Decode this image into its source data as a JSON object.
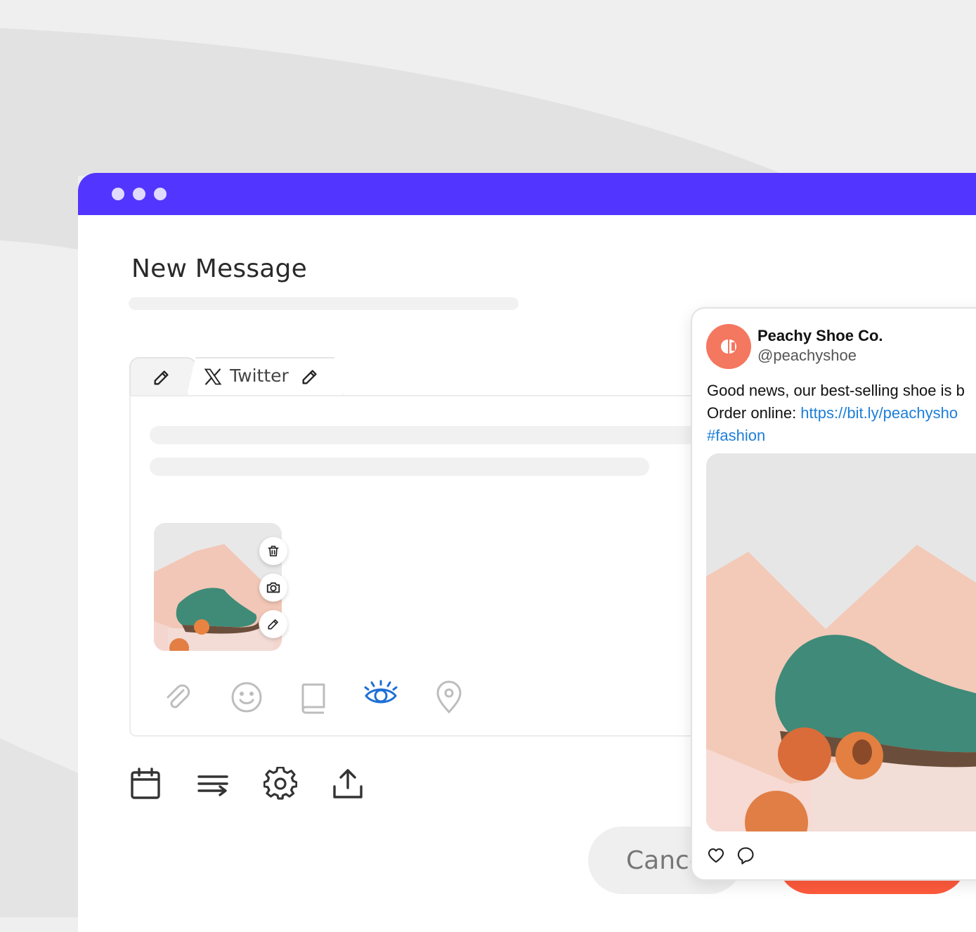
{
  "window": {
    "title": "New Message",
    "accent_color": "#5236ff",
    "tabs": [
      {
        "label": "",
        "icon": "pencil-icon"
      },
      {
        "label": "Twitter",
        "icon": "x-logo-icon",
        "edit_icon": "pencil-icon"
      }
    ],
    "media_actions": [
      "trash-icon",
      "camera-icon",
      "pencil-icon"
    ],
    "editor_tools": [
      "paperclip-icon",
      "smiley-icon",
      "book-icon",
      "eye-icon",
      "location-pin-icon"
    ],
    "active_tool_color": "#1d6fd6",
    "bottom_tools": [
      "calendar-icon",
      "queue-icon",
      "gear-icon",
      "upload-icon"
    ],
    "cancel_label": "Cance"
  },
  "preview": {
    "account_name": "Peachy Shoe Co.",
    "handle": "@peachyshoe",
    "text_line1": "Good news, our best-selling shoe is b",
    "text_line2_prefix": "Order online: ",
    "link": "https://bit.ly/peachysho",
    "hashtag": "#fashion",
    "actions": [
      "heart-icon",
      "comment-icon"
    ]
  }
}
